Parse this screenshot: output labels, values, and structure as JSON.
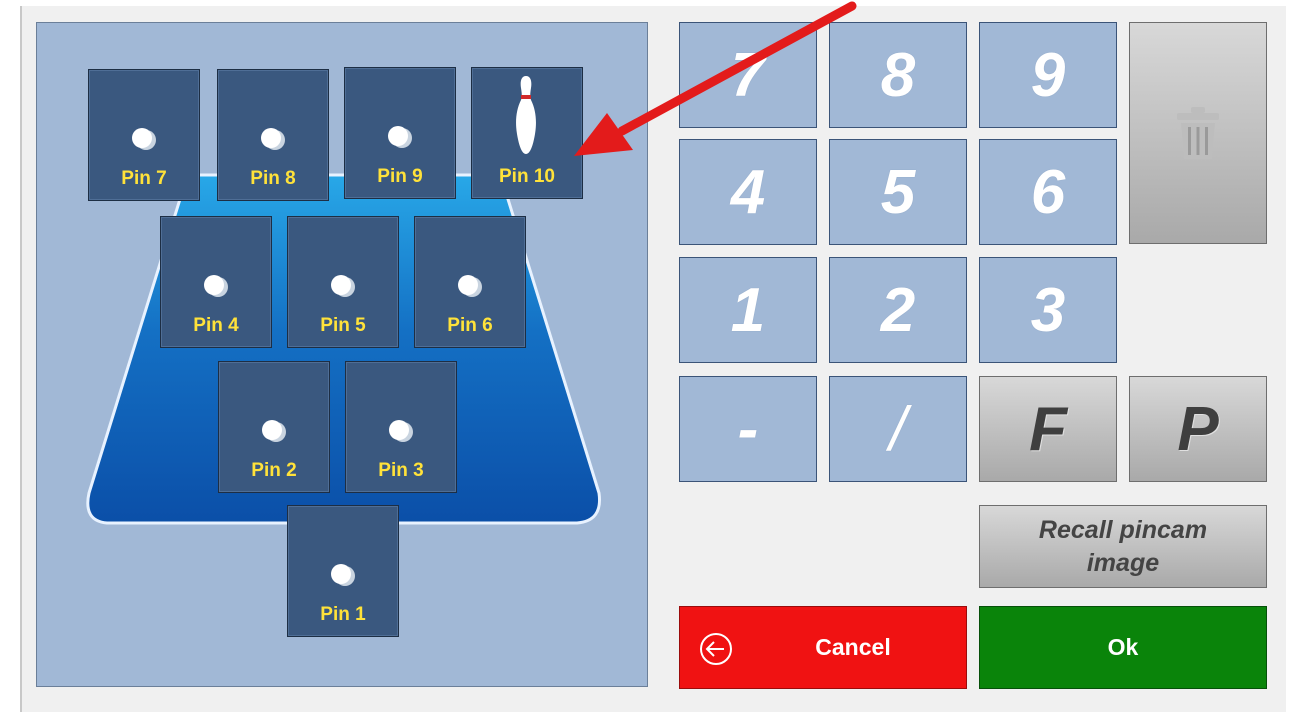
{
  "pins": {
    "pin7": {
      "label": "Pin 7",
      "state": "knocked"
    },
    "pin8": {
      "label": "Pin 8",
      "state": "knocked"
    },
    "pin9": {
      "label": "Pin 9",
      "state": "knocked"
    },
    "pin10": {
      "label": "Pin 10",
      "state": "standing"
    },
    "pin4": {
      "label": "Pin 4",
      "state": "knocked"
    },
    "pin5": {
      "label": "Pin 5",
      "state": "knocked"
    },
    "pin6": {
      "label": "Pin 6",
      "state": "knocked"
    },
    "pin2": {
      "label": "Pin 2",
      "state": "knocked"
    },
    "pin3": {
      "label": "Pin 3",
      "state": "knocked"
    },
    "pin1": {
      "label": "Pin 1",
      "state": "knocked"
    }
  },
  "keypad": {
    "k7": "7",
    "k8": "8",
    "k9": "9",
    "k4": "4",
    "k5": "5",
    "k6": "6",
    "k1": "1",
    "k2": "2",
    "k3": "3",
    "dash": "-",
    "spare": "/",
    "foul": "F",
    "p": "P"
  },
  "actions": {
    "recall_line1": "Recall pincam",
    "recall_line2": "image",
    "cancel": "Cancel",
    "ok": "Ok"
  },
  "icons": {
    "delete": "trash-icon",
    "cancel": "back-arrow-circle-icon",
    "pin_down": "ball-icon",
    "pin_up": "bowling-pin-icon",
    "pointer": "red-arrow-annotation"
  },
  "colors": {
    "panel": "#a1b8d6",
    "pin_tile": "#3a587f",
    "pin_label": "#ffe23a",
    "cancel": "#f01212",
    "ok": "#0a840a",
    "annotation": "#e31b1b"
  }
}
